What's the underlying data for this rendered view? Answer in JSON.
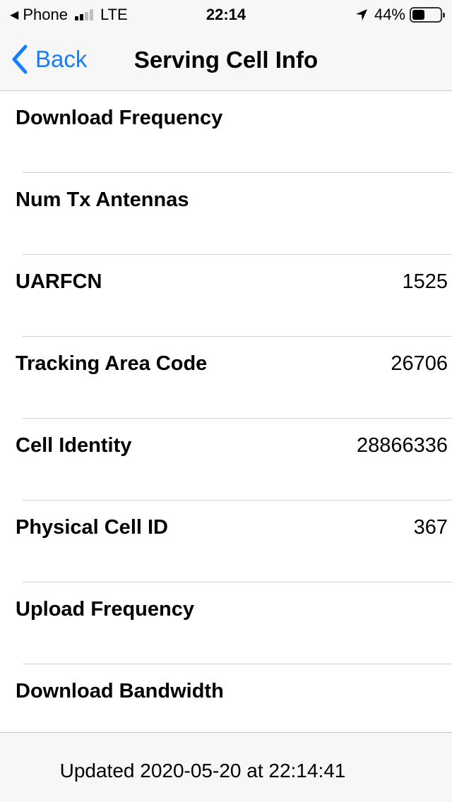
{
  "status_bar": {
    "back_app": "Phone",
    "network": "LTE",
    "time": "22:14",
    "battery": "44%",
    "battery_level": 0.44,
    "signal_bars_filled": 2,
    "signal_bars_total": 4
  },
  "nav": {
    "back_label": "Back",
    "title": "Serving Cell Info"
  },
  "rows": [
    {
      "label": "Download Frequency",
      "value": ""
    },
    {
      "label": "Num Tx Antennas",
      "value": ""
    },
    {
      "label": "UARFCN",
      "value": "1525"
    },
    {
      "label": "Tracking Area Code",
      "value": "26706"
    },
    {
      "label": "Cell Identity",
      "value": "28866336"
    },
    {
      "label": "Physical Cell ID",
      "value": "367"
    },
    {
      "label": "Upload Frequency",
      "value": ""
    },
    {
      "label": "Download Bandwidth",
      "value": ""
    }
  ],
  "footer": {
    "updated_text": "Updated 2020-05-20 at 22:14:41"
  },
  "colors": {
    "accent": "#147efb",
    "bar_bg": "#f7f7f7",
    "separator": "#d1d1d6"
  }
}
